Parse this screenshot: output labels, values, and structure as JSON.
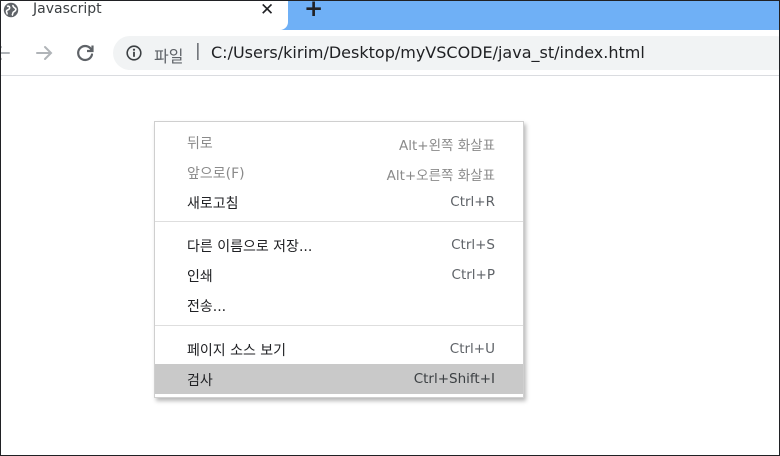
{
  "tab": {
    "title": "Javascript",
    "favicon_icon": "globe-icon",
    "close_icon": "close-icon",
    "new_tab_icon": "plus-icon",
    "new_tab_glyph": "+",
    "close_glyph": "✕"
  },
  "toolbar": {
    "back_icon": "arrow-left-icon",
    "forward_icon": "arrow-right-icon",
    "reload_icon": "reload-icon"
  },
  "omnibox": {
    "info_icon": "info-icon",
    "scheme_label": "파일",
    "separator": "|",
    "url": "C:/Users/kirim/Desktop/myVSCODE/java_st/index.html"
  },
  "context_menu": {
    "items": [
      {
        "label": "뒤로",
        "shortcut": "Alt+왼쪽 화살표",
        "enabled": false
      },
      {
        "label": "앞으로(F)",
        "shortcut": "Alt+오른쪽 화살표",
        "enabled": false
      },
      {
        "label": "새로고침",
        "shortcut": "Ctrl+R",
        "enabled": true
      },
      {
        "label": "다른 이름으로 저장...",
        "shortcut": "Ctrl+S",
        "enabled": true
      },
      {
        "label": "인쇄",
        "shortcut": "Ctrl+P",
        "enabled": true
      },
      {
        "label": "전송...",
        "shortcut": "",
        "enabled": true
      },
      {
        "label": "페이지 소스 보기",
        "shortcut": "Ctrl+U",
        "enabled": true
      },
      {
        "label": "검사",
        "shortcut": "Ctrl+Shift+I",
        "enabled": true,
        "highlighted": true
      }
    ]
  },
  "colors": {
    "tabstrip": "#6fb0f6",
    "omnibox_bg": "#f1f3f4",
    "menu_highlight": "#c9c9c9"
  }
}
